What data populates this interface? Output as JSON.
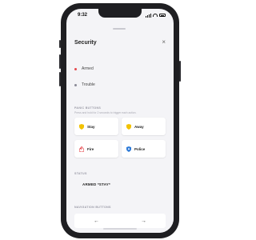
{
  "status_bar": {
    "time": "9:32"
  },
  "panel": {
    "title": "Security",
    "statuses": [
      {
        "label": "Armed",
        "color": "#e5484d"
      },
      {
        "label": "Trouble",
        "color": "#8a8a96"
      }
    ]
  },
  "panic": {
    "heading": "PANIC BUTTONS",
    "hint": "Press and hold for 2 seconds to trigger each action.",
    "buttons": [
      {
        "label": "Stay",
        "icon": "shield-icon",
        "color": "#f2c200"
      },
      {
        "label": "Away",
        "icon": "shield-icon",
        "color": "#f2c200"
      },
      {
        "label": "Fire",
        "icon": "fire-icon",
        "color": "#e5484d"
      },
      {
        "label": "Police",
        "icon": "police-badge-icon",
        "color": "#2f7bd8"
      }
    ]
  },
  "status_section": {
    "heading": "STATUS",
    "value": "ARMED *STAY*"
  },
  "navigation": {
    "heading": "NAVIGATION BUTTONS",
    "back_glyph": "←",
    "forward_glyph": "→"
  },
  "close_glyph": "×"
}
